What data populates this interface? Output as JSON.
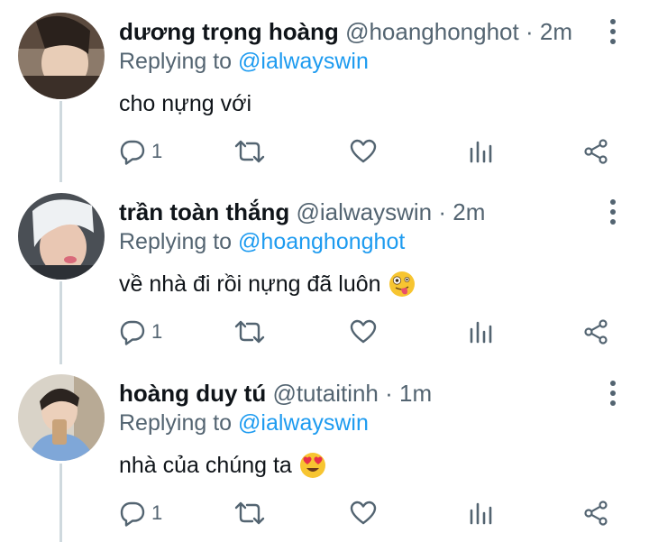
{
  "tweets": [
    {
      "name": "dương trọng hoàng",
      "handle": "@hoanghonghot",
      "time": "2m",
      "replying_prefix": "Replying to",
      "replying_to": "@ialwayswin",
      "text": "cho nựng với",
      "emoji": "",
      "reply_count": "1"
    },
    {
      "name": "trần toàn thắng",
      "handle": "@ialwayswin",
      "time": "2m",
      "replying_prefix": "Replying to",
      "replying_to": "@hoanghonghot",
      "text": "về nhà đi rồi nựng đã luôn",
      "emoji": "zany-face",
      "reply_count": "1"
    },
    {
      "name": "hoàng duy tú",
      "handle": "@tutaitinh",
      "time": "1m",
      "replying_prefix": "Replying to",
      "replying_to": "@ialwayswin",
      "text": "nhà của chúng ta",
      "emoji": "heart-eyes-face",
      "reply_count": "1"
    }
  ],
  "separator": "·",
  "colors": {
    "name": "#0f1419",
    "muted": "#536471",
    "link": "#1d9bf0",
    "thread": "#cfd9de"
  }
}
